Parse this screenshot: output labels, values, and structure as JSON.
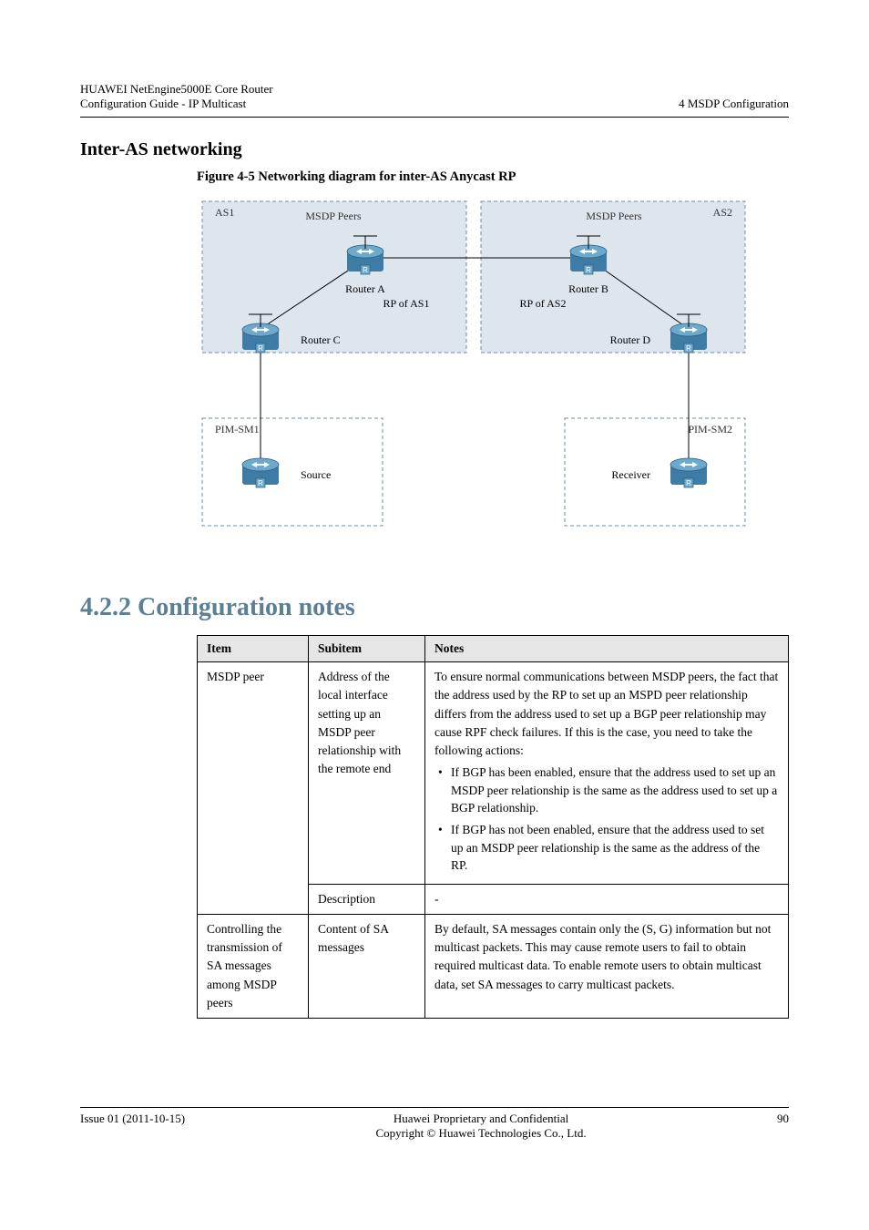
{
  "header": {
    "doc_title": "HUAWEI NetEngine5000E Core Router",
    "doc_subtitle": "Configuration Guide - IP Multicast",
    "chapter": "4 MSDP Configuration"
  },
  "section": {
    "subheading": "Inter-AS networking",
    "figure_caption": "Figure 4-5 Networking diagram for inter-AS Anycast RP",
    "h2": "4.2.2 Configuration notes"
  },
  "diagram": {
    "as1_label": "AS1",
    "as2_label": "AS2",
    "msdp_label": "MSDP Peers",
    "pim1_label": "PIM-SM1",
    "pim2_label": "PIM-SM2",
    "as1_rp": "RP of AS1",
    "as2_rp": "RP of AS2",
    "nodes": {
      "a": "Router A",
      "b": "Router B",
      "c": "Router C",
      "d": "Router D",
      "src": "Source",
      "rcv": "Receiver"
    }
  },
  "table": {
    "columns": [
      "Item",
      "Subitem",
      "Notes"
    ],
    "rows": [
      {
        "item": "MSDP peer",
        "subitem": "Address of the local interface setting up an MSDP peer relationship with the remote end",
        "notes_lead": "To ensure normal communications between MSDP peers, the fact that the address used by the RP to set up an MSPD peer relationship differs from the address used to set up a BGP peer relationship may cause RPF check failures. If this is the case, you need to take the following actions:",
        "notes_bullets": [
          "If BGP has been enabled, ensure that the address used to set up an MSDP peer relationship is the same as the address used to set up a BGP relationship.",
          "If BGP has not been enabled, ensure that the address used to set up an MSDP peer relationship is the same as the address of the RP."
        ]
      },
      {
        "item": "",
        "subitem": "Description",
        "notes_plain": "-"
      },
      {
        "item": "Controlling the transmission of SA messages among MSDP peers",
        "subitem": "Content of SA messages",
        "notes_plain": "By default, SA messages contain only the (S, G) information but not multicast packets. This may cause remote users to fail to obtain required multicast data. To enable remote users to obtain multicast data, set SA messages to carry multicast packets."
      }
    ]
  },
  "footer": {
    "issue": "Issue 01 (2011-10-15)",
    "copyright": "Huawei Proprietary and Confidential",
    "copyright2": "Copyright © Huawei Technologies Co., Ltd.",
    "page": "90"
  }
}
